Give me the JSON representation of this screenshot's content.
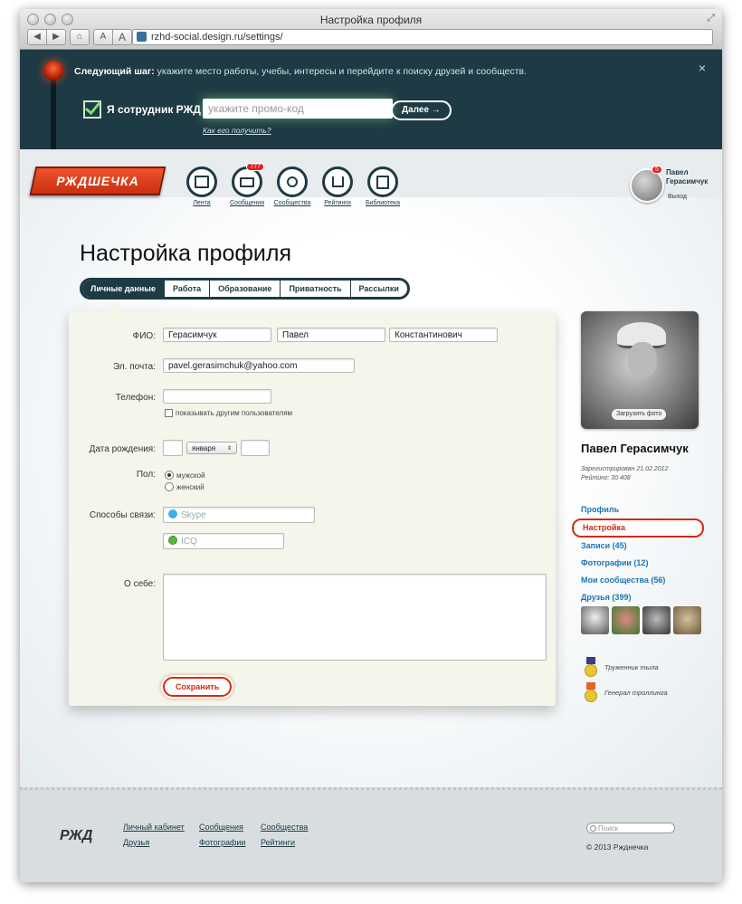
{
  "browser": {
    "title": "Настройка профиля",
    "url": "rzhd-social.design.ru/settings/",
    "nav": {
      "back": "◀",
      "forward": "▶",
      "home": "⌂",
      "font_small": "A",
      "font_large": "A"
    },
    "expand_icon": "⤢"
  },
  "banner": {
    "next_step_label": "Следующий шаг:",
    "next_step_text": " укажите место работы, учебы, интересы и перейдите к поиску друзей и сообществ.",
    "close": "×",
    "employee_label": "Я сотрудник РЖД",
    "promo_placeholder": "укажите промо-код",
    "next_button": "Далее →",
    "how_link": "Как его получить?"
  },
  "header": {
    "logo": "РЖДШЕЧКА",
    "nav": [
      {
        "label": "Лента",
        "icon": "feed-icon"
      },
      {
        "label": "Сообщения",
        "icon": "mail-icon",
        "badge": "777"
      },
      {
        "label": "Сообщества",
        "icon": "communities-icon"
      },
      {
        "label": "Рейтинги",
        "icon": "ratings-icon"
      },
      {
        "label": "Библиотека",
        "icon": "library-icon"
      }
    ],
    "user": {
      "name": "Павел Герасимчук",
      "badge": "5",
      "logout": "Выход"
    }
  },
  "page": {
    "title": "Настройка профиля",
    "tabs": [
      "Личные данные",
      "Работа",
      "Образование",
      "Приватность",
      "Рассылки"
    ],
    "active_tab": "Личные данные"
  },
  "form": {
    "fio_label": "ФИО:",
    "last_name": "Герасимчук",
    "first_name": "Павел",
    "patronymic": "Константинович",
    "email_label": "Эл. почта:",
    "email": "pavel.gerasimchuk@yahoo.com",
    "phone_label": "Телефон:",
    "phone": "",
    "show_phone": "показывать другим пользователям",
    "birthday_label": "Дата рождения:",
    "birth_day": "",
    "birth_month": "января",
    "birth_year": "",
    "gender_label": "Пол:",
    "gender_male": "мужской",
    "gender_female": "женский",
    "contacts_label": "Способы связи:",
    "skype_placeholder": "Skype",
    "icq_placeholder": "ICQ",
    "about_label": "О себе:",
    "save_button": "Сохранить"
  },
  "profile": {
    "upload_photo": "Загрузить фото",
    "name": "Павел Герасимчук",
    "registered": "Зарегистрирован 21.02.2012",
    "rating": "Рейтинг: 30 408",
    "menu": [
      "Профиль",
      "Настройка",
      "Записи (45)",
      "Фотографии (12)",
      "Мои сообщества (56)",
      "Друзья (399)"
    ],
    "active_menu": "Настройка",
    "achievements": [
      "Труженник тыла",
      "Генерал троллинга"
    ]
  },
  "footer": {
    "logo": "РЖД",
    "links": [
      "Личный кабинет",
      "Сообщения",
      "Сообщества",
      "Друзья",
      "Фотографии",
      "Рейтинги"
    ],
    "search_placeholder": "Поиск",
    "copyright": "© 2013 Ржднечка"
  },
  "colors": {
    "accent": "#d42a10",
    "navy": "#1e3a44",
    "link": "#1c75b6"
  }
}
